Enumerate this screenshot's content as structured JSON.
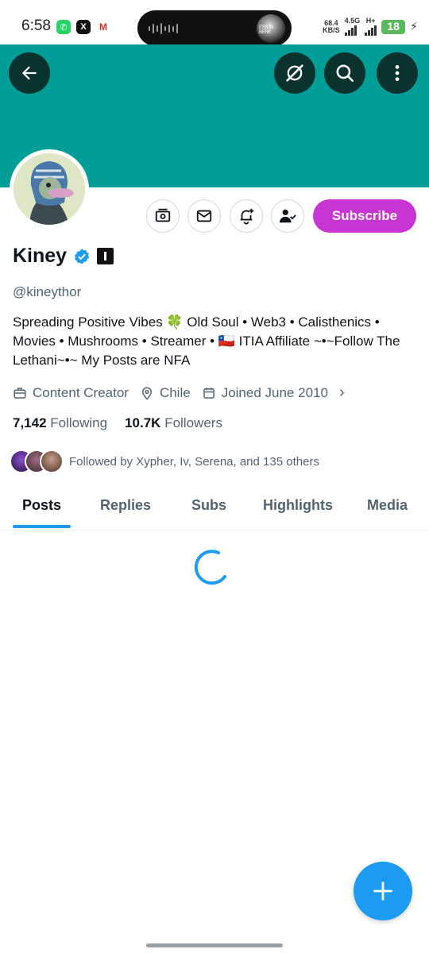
{
  "status_bar": {
    "time": "6:58",
    "speed_value": "68.4",
    "speed_unit": "KB/S",
    "network_1": "4.5G",
    "network_2": "H+",
    "battery": "18",
    "island_thumb_text": "ESS IN BERE",
    "app_icons": [
      "whatsapp-icon",
      "x-icon",
      "gmail-icon"
    ]
  },
  "header": {
    "banner_color": "#009e97",
    "back_icon": "arrow-left-icon",
    "grok_icon": "grok-icon",
    "search_icon": "search-icon",
    "more_icon": "more-vertical-icon"
  },
  "profile": {
    "name": "Kiney",
    "handle": "@kineythor",
    "bio": "Spreading Positive Vibes 🍀  Old Soul • Web3 • Calisthenics • Movies • Mushrooms • Streamer • 🇨🇱  ITIA Affiliate  ~•~Follow The Lethani~•~  My Posts are NFA",
    "profession": "Content Creator",
    "location": "Chile",
    "joined": "Joined June 2010",
    "following_count": "7,142",
    "following_label": "Following",
    "followers_count": "10.7K",
    "followers_label": "Followers",
    "followed_by": "Followed by Xypher, Iv, Serena, and 135 others"
  },
  "actions": {
    "subscribe_label": "Subscribe",
    "subscribe_color": "#c935d3"
  },
  "tabs": [
    "Posts",
    "Replies",
    "Subs",
    "Highlights",
    "Media"
  ],
  "accent_color": "#1d9bf0"
}
